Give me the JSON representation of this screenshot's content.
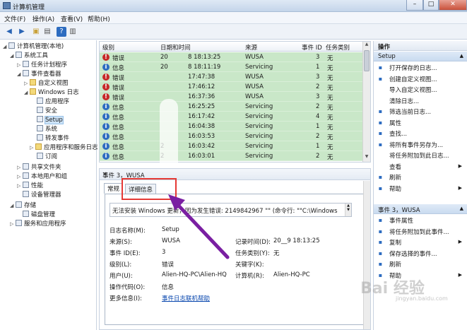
{
  "window": {
    "title": "计算机管理",
    "min": "–",
    "max": "□",
    "close": "✕"
  },
  "menu": [
    "文件(F)",
    "操作(A)",
    "查看(V)",
    "帮助(H)"
  ],
  "toolbar": {
    "back": "◀",
    "forward": "▶",
    "up": "▣",
    "show_hide": "▤",
    "help": "?",
    "props": "▥"
  },
  "tree": [
    {
      "label": "计算机管理(本地)",
      "icon": "computer-icon"
    },
    {
      "label": "系统工具",
      "icon": "tools-icon"
    },
    {
      "label": "任务计划程序",
      "icon": "clock-icon"
    },
    {
      "label": "事件查看器",
      "icon": "event-viewer-icon"
    },
    {
      "label": "自定义视图",
      "icon": "folder-icon"
    },
    {
      "label": "Windows 日志",
      "icon": "folder-icon"
    },
    {
      "label": "应用程序",
      "icon": "log-icon"
    },
    {
      "label": "安全",
      "icon": "log-icon"
    },
    {
      "label": "Setup",
      "icon": "log-icon"
    },
    {
      "label": "系统",
      "icon": "log-icon"
    },
    {
      "label": "转发事件",
      "icon": "log-icon"
    },
    {
      "label": "应用程序和服务日志",
      "icon": "folder-icon"
    },
    {
      "label": "订阅",
      "icon": "subscription-icon"
    },
    {
      "label": "共享文件夹",
      "icon": "shared-folder-icon"
    },
    {
      "label": "本地用户和组",
      "icon": "users-icon"
    },
    {
      "label": "性能",
      "icon": "performance-icon"
    },
    {
      "label": "设备管理器",
      "icon": "device-icon"
    },
    {
      "label": "存储",
      "icon": "storage-icon"
    },
    {
      "label": "磁盘管理",
      "icon": "disk-icon"
    },
    {
      "label": "服务和应用程序",
      "icon": "services-icon"
    }
  ],
  "grid": {
    "columns": [
      "级别",
      "日期和时间",
      "来源",
      "事件 ID",
      "任务类别"
    ],
    "rows": [
      {
        "level": "错误",
        "type": "err",
        "date": "20",
        "time": "8 18:13:25",
        "source": "WUSA",
        "id": "3",
        "cat": "无"
      },
      {
        "level": "信息",
        "type": "info",
        "date": "20",
        "time": "8 18:11:19",
        "source": "Servicing",
        "id": "1",
        "cat": "无"
      },
      {
        "level": "错误",
        "type": "err",
        "date": "",
        "time": "17:47:38",
        "source": "WUSA",
        "id": "3",
        "cat": "无"
      },
      {
        "level": "错误",
        "type": "err",
        "date": "",
        "time": "17:46:12",
        "source": "WUSA",
        "id": "2",
        "cat": "无"
      },
      {
        "level": "错误",
        "type": "err",
        "date": "",
        "time": "16:37:36",
        "source": "WUSA",
        "id": "3",
        "cat": "无"
      },
      {
        "level": "信息",
        "type": "info",
        "date": "",
        "time": "16:25:25",
        "source": "Servicing",
        "id": "2",
        "cat": "无"
      },
      {
        "level": "信息",
        "type": "info",
        "date": "",
        "time": "16:17:42",
        "source": "Servicing",
        "id": "4",
        "cat": "无"
      },
      {
        "level": "信息",
        "type": "info",
        "date": "",
        "time": "16:04:38",
        "source": "Servicing",
        "id": "1",
        "cat": "无"
      },
      {
        "level": "信息",
        "type": "info",
        "date": "",
        "time": "16:03:53",
        "source": "Servicing",
        "id": "2",
        "cat": "无"
      },
      {
        "level": "信息",
        "type": "info",
        "date": "2",
        "time": "16:03:42",
        "source": "Servicing",
        "id": "1",
        "cat": "无"
      },
      {
        "level": "信息",
        "type": "info",
        "date": "2",
        "time": "16:03:01",
        "source": "Servicing",
        "id": "2",
        "cat": "无"
      }
    ]
  },
  "detail": {
    "header": "事件 3，WUSA",
    "close": "×",
    "tabs": [
      "常规",
      "详细信息"
    ],
    "message": "无法安装 Windows 更新，因为发生错误: 2149842967 \"\" (命令行: \"\"C:\\Windows",
    "fields": {
      "log_name_label": "日志名称(M):",
      "log_name": "Setup",
      "source_label": "来源(S):",
      "source": "WUSA",
      "logged_label": "记录时间(D):",
      "logged": "20__9 18:13:25",
      "event_id_label": "事件 ID(E):",
      "event_id": "3",
      "task_label": "任务类别(Y):",
      "task": "无",
      "level_label": "级别(L):",
      "level": "错误",
      "keywords_label": "关键字(K):",
      "user_label": "用户(U):",
      "user": "Alien-HQ-PC\\Alien-HQ",
      "computer_label": "计算机(R):",
      "computer": "Alien-HQ-PC",
      "opcode_label": "操作代码(O):",
      "opcode": "信息",
      "more_label": "更多信息(I):",
      "more_link": "事件日志联机帮助"
    }
  },
  "actions": {
    "header": "操作",
    "group1": "Setup",
    "items1": [
      {
        "label": "打开保存的日志...",
        "icon": "open-log-icon"
      },
      {
        "label": "创建自定义视图...",
        "icon": "filter-create-icon"
      },
      {
        "label": "导入自定义视图...",
        "icon": ""
      },
      {
        "label": "清除日志...",
        "icon": ""
      },
      {
        "label": "筛选当前日志...",
        "icon": "filter-icon"
      },
      {
        "label": "属性",
        "icon": "properties-icon"
      },
      {
        "label": "查找...",
        "icon": "find-icon"
      },
      {
        "label": "将所有事件另存为...",
        "icon": "save-icon"
      },
      {
        "label": "将任务附加到此日志...",
        "icon": ""
      },
      {
        "label": "查看",
        "icon": "",
        "sub": true
      },
      {
        "label": "刷新",
        "icon": "refresh-icon"
      },
      {
        "label": "帮助",
        "icon": "help-icon",
        "sub": true
      }
    ],
    "group2": "事件 3，WUSA",
    "items2": [
      {
        "label": "事件属性",
        "icon": "event-props-icon"
      },
      {
        "label": "将任务附加到此事件...",
        "icon": "attach-task-icon"
      },
      {
        "label": "复制",
        "icon": "copy-icon",
        "sub": true
      },
      {
        "label": "保存选择的事件...",
        "icon": "save-icon"
      },
      {
        "label": "刷新",
        "icon": "refresh-icon"
      },
      {
        "label": "帮助",
        "icon": "help-icon",
        "sub": true
      }
    ]
  },
  "watermark": {
    "main": "Bai 经验",
    "sub": "jingyan.baidu.com"
  }
}
